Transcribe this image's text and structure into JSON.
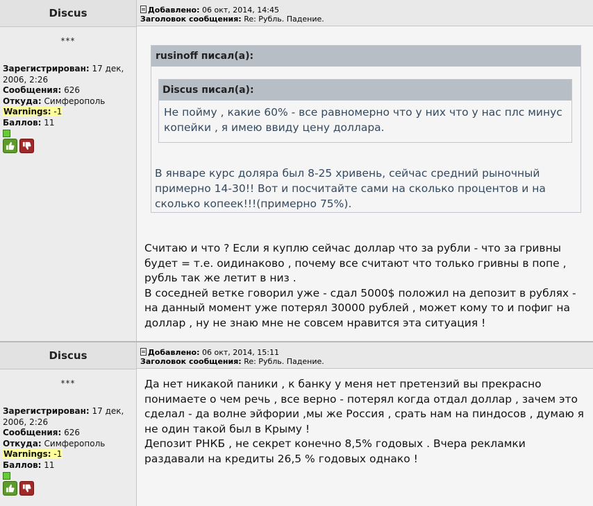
{
  "posts": [
    {
      "author": "Discus",
      "rank": "***",
      "registered_label": "Зарегистрирован:",
      "registered_value": "17 дек, 2006, 2:26",
      "messages_label": "Сообщения:",
      "messages_value": "626",
      "from_label": "Откуда:",
      "from_value": "Симферополь",
      "warnings_label": "Warnings:",
      "warnings_value": "-1",
      "points_label": "Баллов:",
      "points_value": "11",
      "added_label": "Добавлено:",
      "added_value": "06 окт, 2014, 14:45",
      "subject_label": "Заголовок сообщения:",
      "subject_value": "Re: Рубль. Падение.",
      "quote": {
        "author_label": "rusinoff писал(а):",
        "inner_author_label": "Discus писал(а):",
        "inner_text": "Не пойму , какие 60% - все равномерно что у них что у нас плс минус копейки , я имею ввиду цену доллара.",
        "text": "В январе курс доляра был 8-25 хривень, сейчас средний рыночный примерно 14-30!! Вот и посчитайте сами на сколько процентов и на сколько копеек!!!(примерно 75%)."
      },
      "body_lines": [
        "Считаю и что ? Если я куплю сейчас доллар что за рубли - что за гривны будет = т.е. оидинаково , почему все считают что только гривны в попе , рубль так же летит в низ .",
        "В соседней ветке говорил уже - сдал 5000$ положил на депозит в рублях - на данный момент уже потерял 30000 рублей , может кому то и пофиг на доллар , ну не знаю мне не совсем нравится эта ситуация !"
      ]
    },
    {
      "author": "Discus",
      "rank": "***",
      "registered_label": "Зарегистрирован:",
      "registered_value": "17 дек, 2006, 2:26",
      "messages_label": "Сообщения:",
      "messages_value": "626",
      "from_label": "Откуда:",
      "from_value": "Симферополь",
      "warnings_label": "Warnings:",
      "warnings_value": "-1",
      "points_label": "Баллов:",
      "points_value": "11",
      "added_label": "Добавлено:",
      "added_value": "06 окт, 2014, 15:11",
      "subject_label": "Заголовок сообщения:",
      "subject_value": "Re: Рубль. Падение.",
      "body_lines": [
        "Да нет никакой паники , к банку у меня нет претензий вы прекрасно понимаете о чем речь , все верно - потерял когда отдал доллар , зачем это сделал - да волне эйфории ,мы же Россия , срать нам на пиндосов , думаю я не один такой был в Крыму !",
        "Депозит РНКБ , не секрет конечно 8,5% годовых . Вчера рекламки раздавали на кредиты 26,5 % годовых однако !"
      ]
    }
  ],
  "icons": {
    "online": "online-status-icon",
    "vote_up": "thumb-up-icon",
    "vote_down": "thumb-down-icon",
    "post_doc": "post-document-icon"
  },
  "colors": {
    "quote_header": "#b8bec6",
    "quote_text": "#34495e",
    "warnings_highlight": "#ffff99",
    "vote_up": "#5f9a2c",
    "vote_down": "#a02828"
  }
}
